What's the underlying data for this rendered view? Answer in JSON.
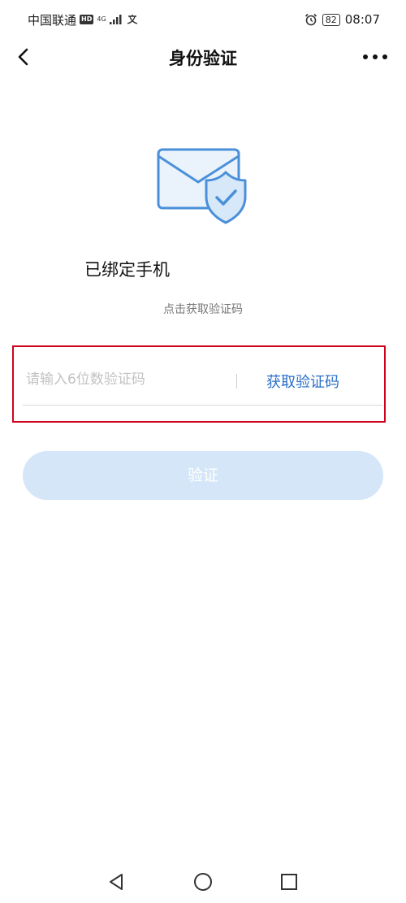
{
  "status_bar": {
    "carrier": "中国联通",
    "hd_label": "HD",
    "network_label": "4G",
    "battery": "82",
    "time": "08:07"
  },
  "nav": {
    "title": "身份验证"
  },
  "content": {
    "bound_title": "已绑定手机",
    "hint": "点击获取验证码",
    "code_placeholder": "请输入6位数验证码",
    "code_value": "",
    "get_code_label": "获取验证码",
    "verify_label": "验证"
  },
  "colors": {
    "accent": "#2a6fc9",
    "verify_button_disabled": "#d4e6f8",
    "highlight_border": "#d0021b",
    "illustration_blue": "#4a90d9"
  },
  "icons": {
    "back": "chevron-left-icon",
    "more": "more-dots-icon",
    "illustration": "envelope-shield-check-icon",
    "alarm": "alarm-clock-icon",
    "signal": "signal-icon",
    "sys_back": "triangle-back-icon",
    "sys_home": "circle-home-icon",
    "sys_recent": "square-recent-icon"
  }
}
